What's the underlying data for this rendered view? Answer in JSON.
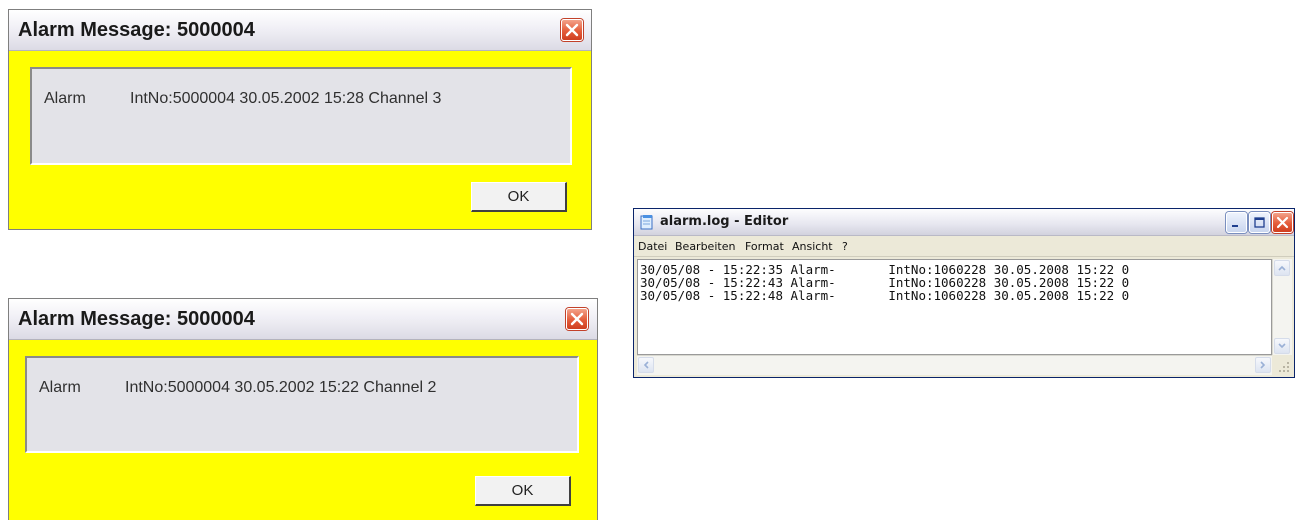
{
  "dialogs": [
    {
      "title": "Alarm Message: 5000004",
      "label": "Alarm",
      "message": "IntNo:5000004 30.05.2002 15:28 Channel 3",
      "ok_label": "OK"
    },
    {
      "title": "Alarm Message: 5000004",
      "label": "Alarm",
      "message": "IntNo:5000004 30.05.2002 15:22 Channel 2",
      "ok_label": "OK"
    }
  ],
  "editor": {
    "title": "alarm.log - Editor",
    "menu": [
      "Datei",
      "Bearbeiten",
      "Format",
      "Ansicht",
      "?"
    ],
    "lines": [
      "30/05/08 - 15:22:35 Alarm-       IntNo:1060228 30.05.2008 15:22 0",
      "30/05/08 - 15:22:43 Alarm-       IntNo:1060228 30.05.2008 15:22 0",
      "30/05/08 - 15:22:48 Alarm-       IntNo:1060228 30.05.2008 15:22 0"
    ]
  },
  "colors": {
    "dialog_bg": "#ffff00",
    "message_box_bg": "#e3e3e8",
    "close_button": "#e45c3a"
  },
  "icons": {
    "close": "close-icon",
    "minimize": "minimize-icon",
    "maximize": "maximize-icon",
    "notepad": "notepad-icon"
  }
}
